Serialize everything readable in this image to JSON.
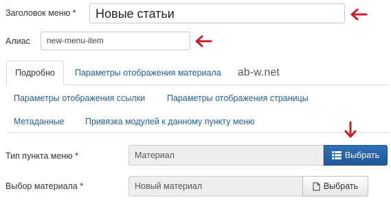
{
  "form": {
    "title_label": "Заголовок меню *",
    "title_value": "Новые статьи",
    "alias_label": "Алиас",
    "alias_value": "new-menu-item"
  },
  "tabs": [
    {
      "label": "Подробно",
      "active": true
    },
    {
      "label": "Параметры отображения материала",
      "active": false
    },
    {
      "label": "Параметры отображения ссылки",
      "active": false
    },
    {
      "label": "Параметры отображения страницы",
      "active": false
    },
    {
      "label": "Метаданные",
      "active": false
    },
    {
      "label": "Привязка модулей к данному пункту меню",
      "active": false
    }
  ],
  "watermark": "ab-w.net",
  "fields": {
    "menu_type_label": "Тип пункта меню *",
    "menu_type_value": "Материал",
    "menu_type_button": "Выбрать",
    "article_label": "Выбор материала *",
    "article_value": "Новый материал",
    "article_button": "Выбрать"
  },
  "icons": {
    "annotation": "red-arrow-icon",
    "list": "list-icon",
    "file": "file-icon"
  },
  "colors": {
    "link": "#1f5d98",
    "primary_button": "#1e5799",
    "annotation_arrow": "#cc1c2a"
  }
}
